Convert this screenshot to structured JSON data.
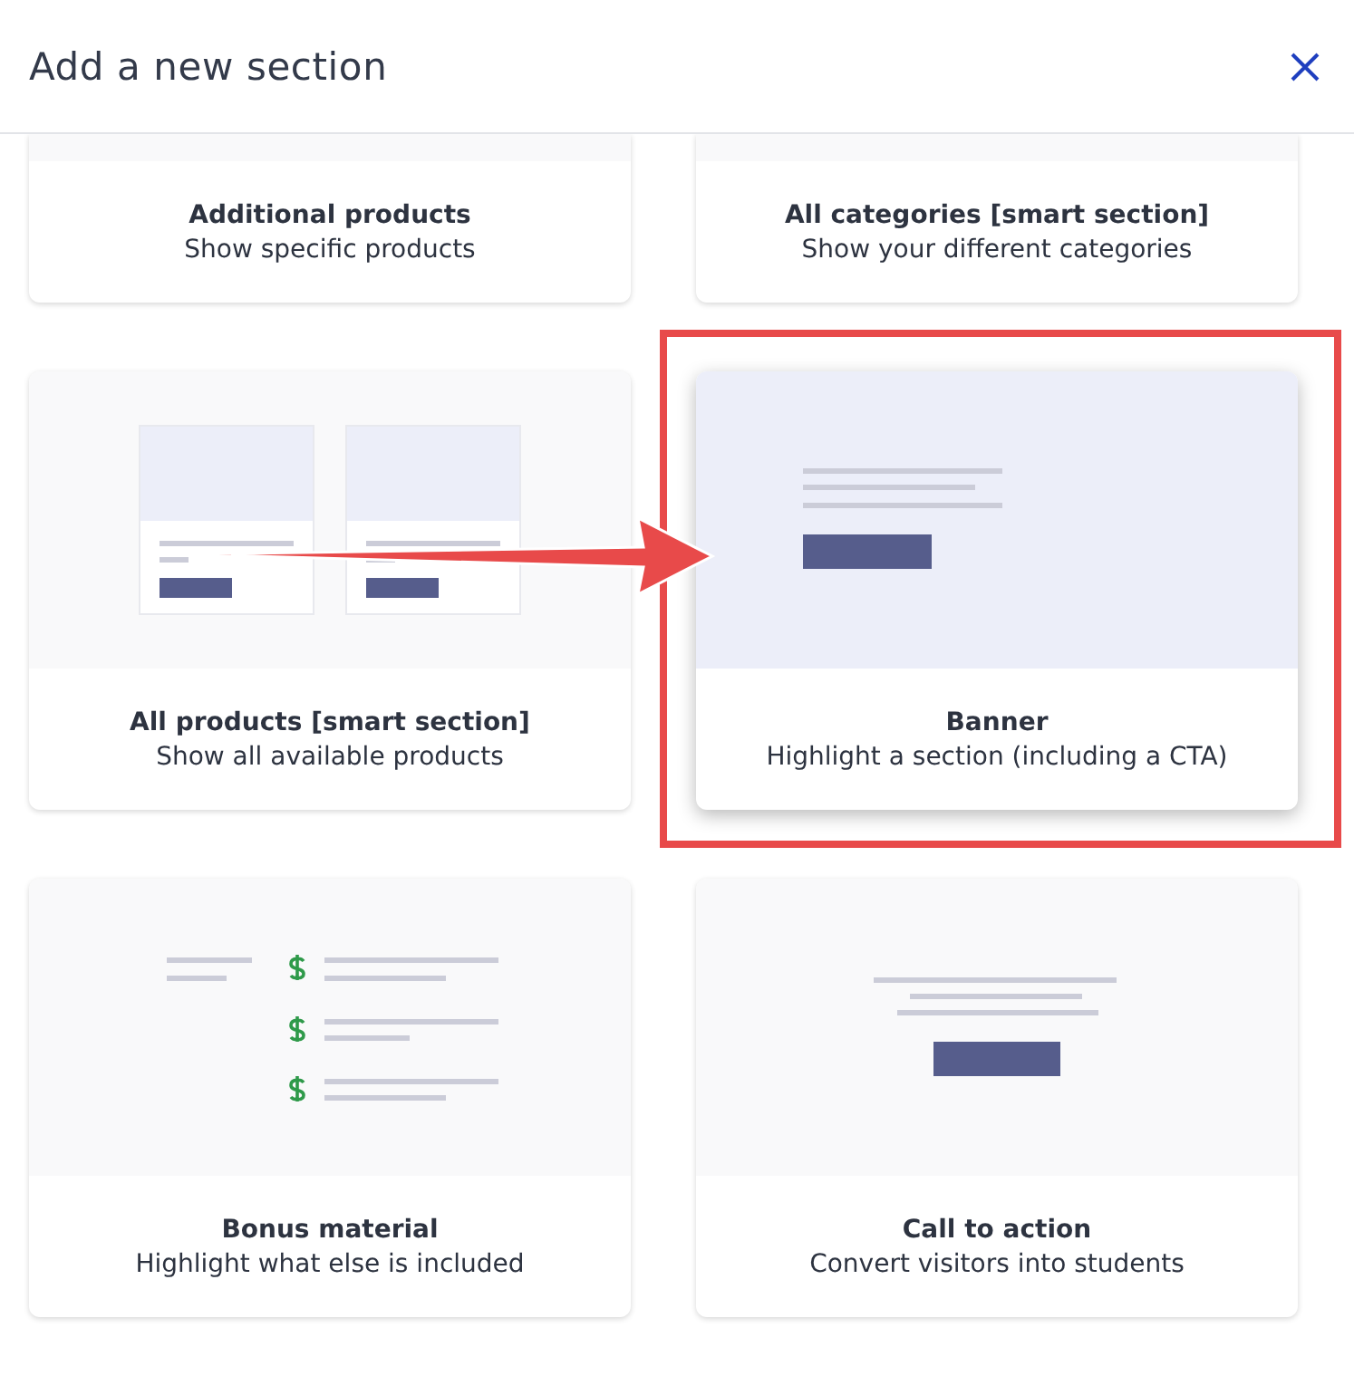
{
  "dialog": {
    "title": "Add a new section"
  },
  "sections": [
    {
      "kind": "cropped",
      "title": "Additional products",
      "description": "Show specific products",
      "selected": false
    },
    {
      "kind": "cropped",
      "title": "All categories [smart section]",
      "description": "Show your different categories",
      "selected": false
    },
    {
      "kind": "product-cards",
      "title": "All products [smart section]",
      "description": "Show all available products",
      "selected": false
    },
    {
      "kind": "banner",
      "title": "Banner",
      "description": "Highlight a section (including a CTA)",
      "selected": true
    },
    {
      "kind": "bonus",
      "title": "Bonus material",
      "description": "Highlight what else is included",
      "selected": false
    },
    {
      "kind": "cta",
      "title": "Call to action",
      "description": "Convert visitors into students",
      "selected": false
    }
  ]
}
